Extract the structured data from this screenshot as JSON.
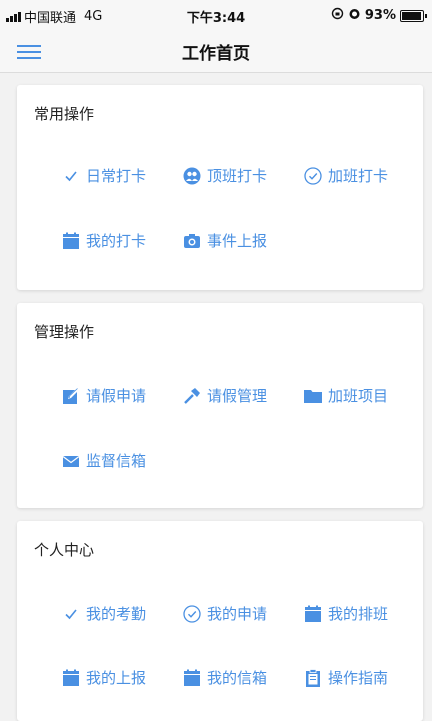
{
  "status_bar": {
    "carrier": "中国联通",
    "network": "4G",
    "time": "下午3:44",
    "battery": "93%",
    "battery_level": 0.93
  },
  "nav": {
    "title": "工作首页"
  },
  "sections": [
    {
      "title": "常用操作",
      "actions": [
        {
          "label": "日常打卡",
          "icon": "check-icon"
        },
        {
          "label": "顶班打卡",
          "icon": "users-icon"
        },
        {
          "label": "加班打卡",
          "icon": "check-circle-icon"
        },
        {
          "label": "我的打卡",
          "icon": "calendar-icon"
        },
        {
          "label": "事件上报",
          "icon": "camera-icon"
        }
      ]
    },
    {
      "title": "管理操作",
      "actions": [
        {
          "label": "请假申请",
          "icon": "edit-icon"
        },
        {
          "label": "请假管理",
          "icon": "hammer-icon"
        },
        {
          "label": "加班项目",
          "icon": "folder-icon"
        },
        {
          "label": "监督信箱",
          "icon": "envelope-icon"
        }
      ]
    },
    {
      "title": "个人中心",
      "actions": [
        {
          "label": "我的考勤",
          "icon": "check-icon"
        },
        {
          "label": "我的申请",
          "icon": "check-circle-icon"
        },
        {
          "label": "我的排班",
          "icon": "calendar-icon"
        },
        {
          "label": "我的上报",
          "icon": "calendar-icon"
        },
        {
          "label": "我的信箱",
          "icon": "calendar-icon"
        },
        {
          "label": "操作指南",
          "icon": "clipboard-icon"
        }
      ]
    }
  ],
  "colors": {
    "accent": "#4a90e2",
    "background": "#f2f2f2",
    "card": "#ffffff"
  }
}
